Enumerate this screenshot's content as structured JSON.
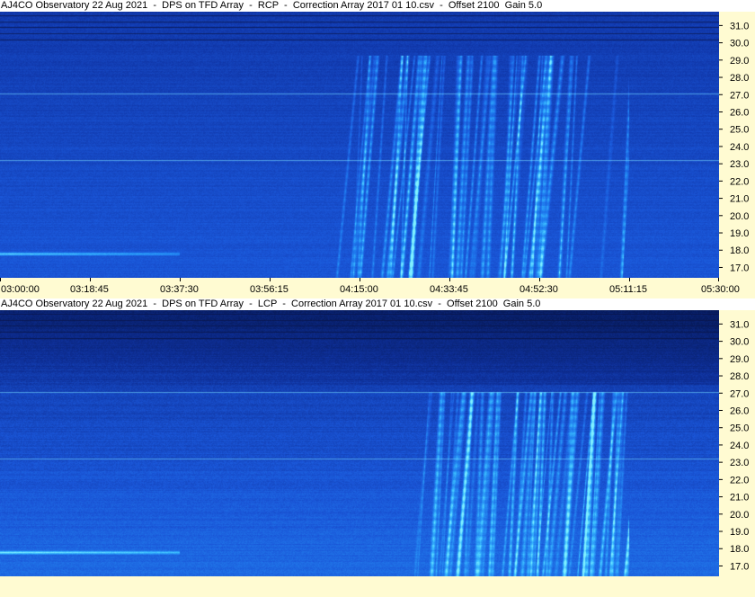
{
  "chart_data": [
    {
      "type": "heatmap",
      "title": "AJ4CO Observatory 22 Aug 2021  -  DPS on TFD Array  -  RCP  -  Correction Array 2017 01 10.csv  -  Offset 2100  Gain 5.0",
      "polarization": "RCP",
      "xlabel": "",
      "ylabel": "",
      "x_ticks": [
        "03:00:00",
        "03:18:45",
        "03:37:30",
        "03:56:15",
        "04:15:00",
        "04:33:45",
        "04:52:30",
        "05:11:15",
        "05:30:00"
      ],
      "xlim": [
        "03:00:00",
        "05:30:00"
      ],
      "y_ticks": [
        "17.0",
        "18.0",
        "19.0",
        "20.0",
        "21.0",
        "22.0",
        "23.0",
        "24.0",
        "25.0",
        "26.0",
        "27.0",
        "28.0",
        "29.0",
        "30.0",
        "31.0"
      ],
      "ylim": [
        16.4,
        31.8
      ],
      "colormap": [
        "#08206a",
        "#1036a8",
        "#1a56d8",
        "#1f7ef0",
        "#38b8ff",
        "#80f0ff"
      ],
      "features": [
        {
          "kind": "horizontal-band",
          "freq": 17.8,
          "t_start": "03:00:00",
          "t_end": "03:37:30"
        },
        {
          "kind": "emission-region",
          "t_start": "04:15:00",
          "t_end": "05:11:15",
          "freq_range": [
            16.8,
            29.3
          ]
        }
      ]
    },
    {
      "type": "heatmap",
      "title": "AJ4CO Observatory 22 Aug 2021  -  DPS on TFD Array  -  LCP  -  Correction Array 2017 01 10.csv  -  Offset 2100  Gain 5.0",
      "polarization": "LCP",
      "xlabel": "",
      "ylabel": "",
      "y_ticks": [
        "17.0",
        "18.0",
        "19.0",
        "20.0",
        "21.0",
        "22.0",
        "23.0",
        "24.0",
        "25.0",
        "26.0",
        "27.0",
        "28.0",
        "29.0",
        "30.0",
        "31.0"
      ],
      "ylim": [
        16.4,
        31.8
      ],
      "colormap": [
        "#061a5a",
        "#0e2f98",
        "#1a56d8",
        "#2488f2",
        "#3cc0ff",
        "#80f0ff"
      ],
      "features": [
        {
          "kind": "horizontal-band",
          "freq": 17.8,
          "t_start": "03:00:00",
          "t_end": "03:37:30"
        },
        {
          "kind": "emission-region",
          "t_start": "04:33:45",
          "t_end": "05:11:15",
          "freq_range": [
            16.8,
            27.1
          ]
        }
      ]
    }
  ]
}
